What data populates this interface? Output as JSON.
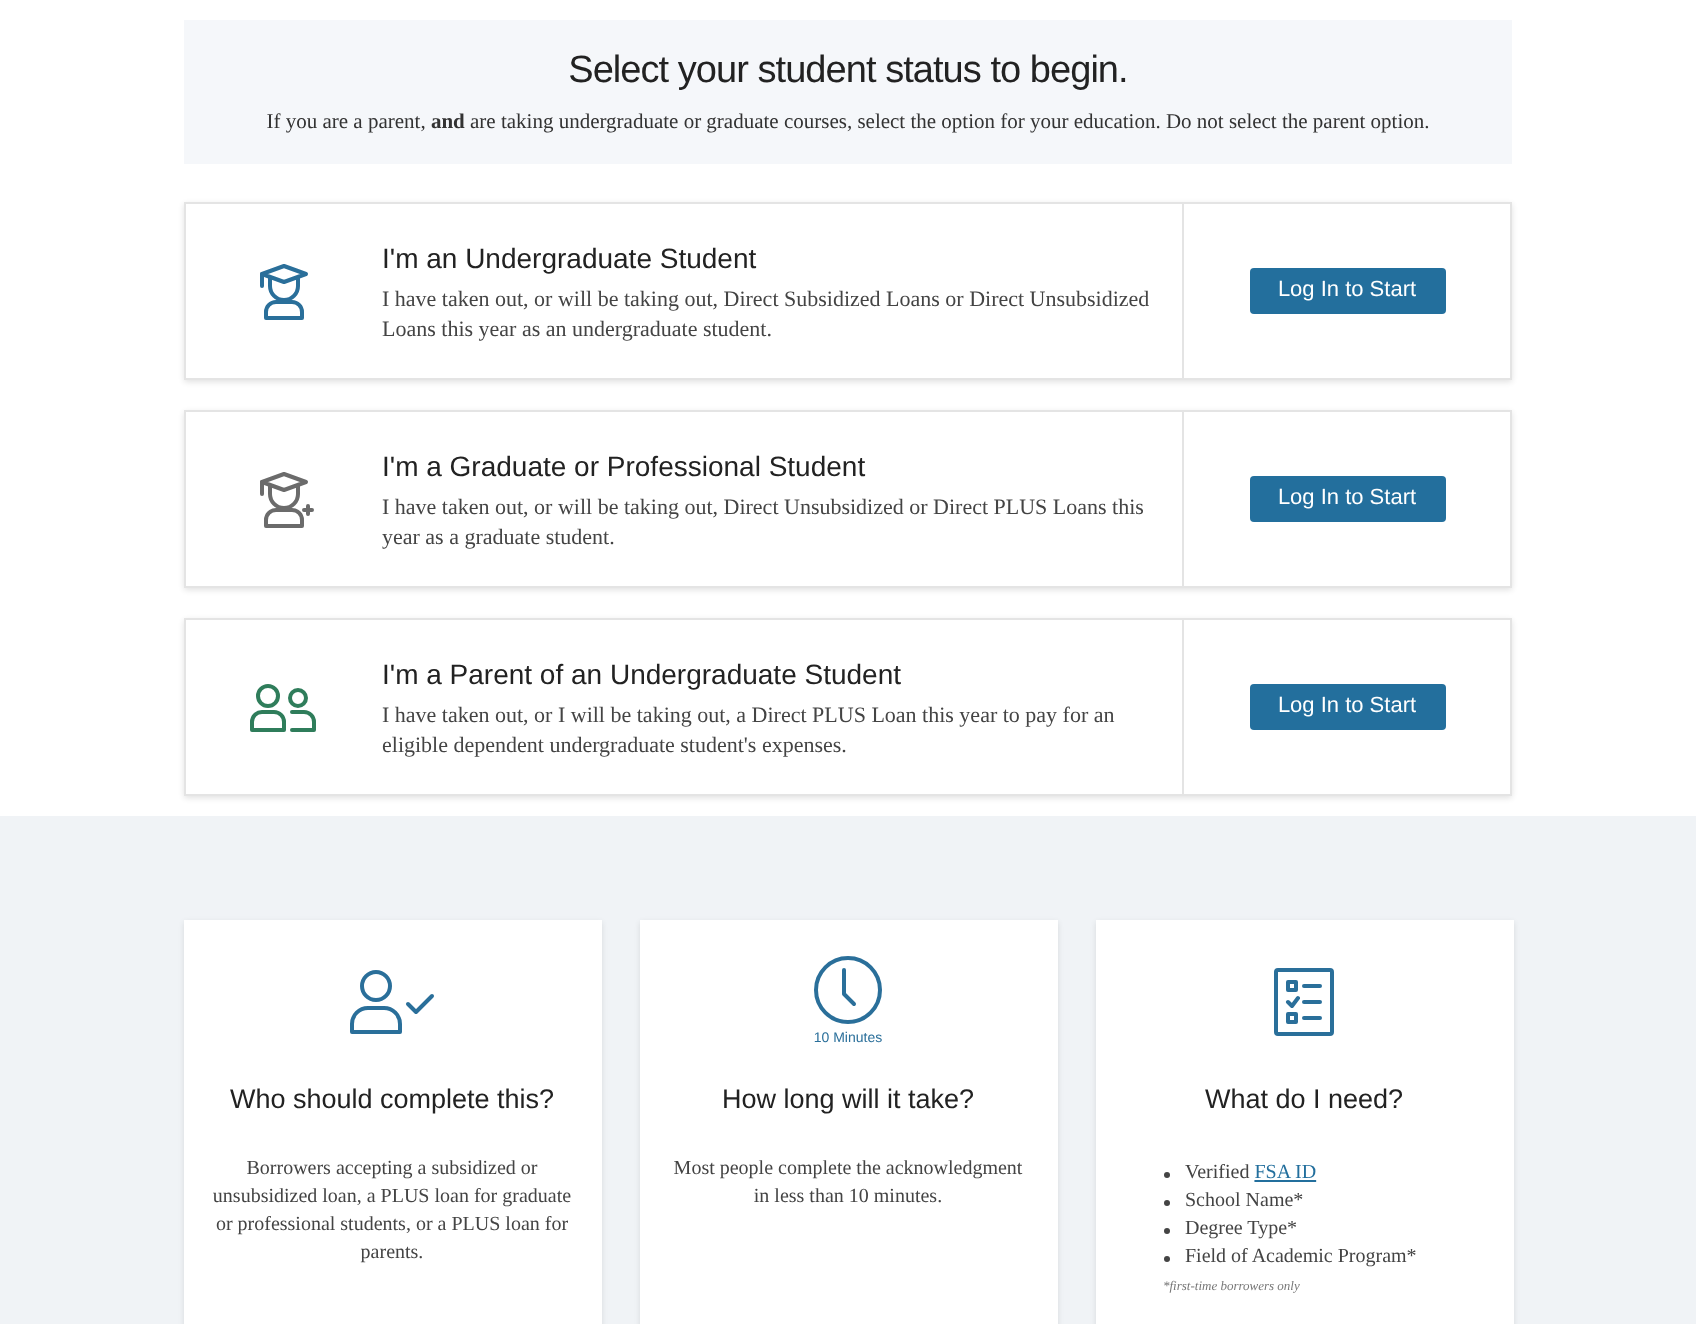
{
  "header": {
    "title": "Select your student status to begin.",
    "note": "If you are a parent, **and** are taking undergraduate or graduate courses, select the option for your education. Do not select the parent option."
  },
  "options": [
    {
      "kind": "student",
      "color": "#2a6f9a",
      "title": "I'm an Undergraduate Student",
      "text": "I have taken out, or will be taking out, Direct Subsidized Loans or Direct Unsubsidized Loans this year as an undergraduate student.",
      "button": "Log In to Start"
    },
    {
      "kind": "graduate",
      "color": "#6b6b6b",
      "title": "I'm a Graduate or Professional Student",
      "text": "I have taken out, or will be taking out, Direct Unsubsidized or Direct PLUS Loans this year as a graduate student.",
      "button": "Log In to Start"
    },
    {
      "kind": "parent",
      "color": "#2f7d5b",
      "title": "I'm a Parent of an Undergraduate Student",
      "text": "I have taken out, or I will be taking out, a Direct PLUS Loan this year to pay for an eligible dependent undergraduate student's expenses.",
      "button": "Log In to Start"
    }
  ],
  "info_cards": [
    {
      "kind": "person-check",
      "title": "Who should complete this?",
      "text": "Borrowers accepting a subsidized or unsubsidized loan, a PLUS loan for graduate or professional students, or a PLUS loan for parents."
    },
    {
      "kind": "clock",
      "icon_caption": "10 Minutes",
      "title": "How long will it take?",
      "text": "Most people complete the acknowledgment in less than 10 minutes."
    },
    {
      "kind": "checklist",
      "title": "What do I need?",
      "items": [
        {
          "text": "Verified",
          "link": "FSA ID"
        },
        {
          "text": "School Name*"
        },
        {
          "text": "Degree Type*"
        },
        {
          "text": "Field of Academic Program*"
        }
      ],
      "footnote": "*first-time borrowers only"
    }
  ]
}
